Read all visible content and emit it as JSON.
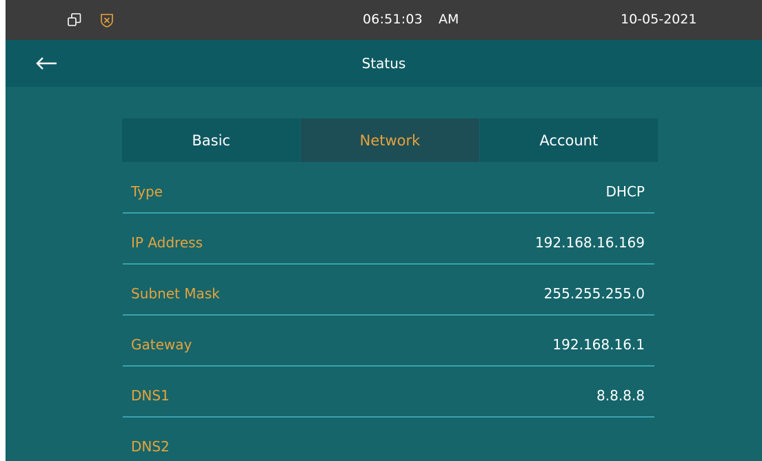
{
  "status_bar": {
    "time": "06:51:03",
    "ampm": "AM",
    "date": "10-05-2021",
    "icons": [
      "copy-windows-icon",
      "shield-icon"
    ]
  },
  "header": {
    "back_icon": "arrow-left-icon",
    "title": "Status"
  },
  "tabs": [
    {
      "label": "Basic",
      "active": false
    },
    {
      "label": "Network",
      "active": true
    },
    {
      "label": "Account",
      "active": false
    }
  ],
  "network": {
    "rows": [
      {
        "label": "Type",
        "value": "DHCP"
      },
      {
        "label": "IP Address",
        "value": "192.168.16.169"
      },
      {
        "label": "Subnet Mask",
        "value": "255.255.255.0"
      },
      {
        "label": "Gateway",
        "value": "192.168.16.1"
      },
      {
        "label": "DNS1",
        "value": "8.8.8.8"
      },
      {
        "label": "DNS2",
        "value": ""
      }
    ]
  },
  "colors": {
    "background": "#15656a",
    "status_bar": "#3c3c3c",
    "title_bar": "#0d5a62",
    "accent_orange": "#e8a23c",
    "divider": "#3aa3ac"
  }
}
